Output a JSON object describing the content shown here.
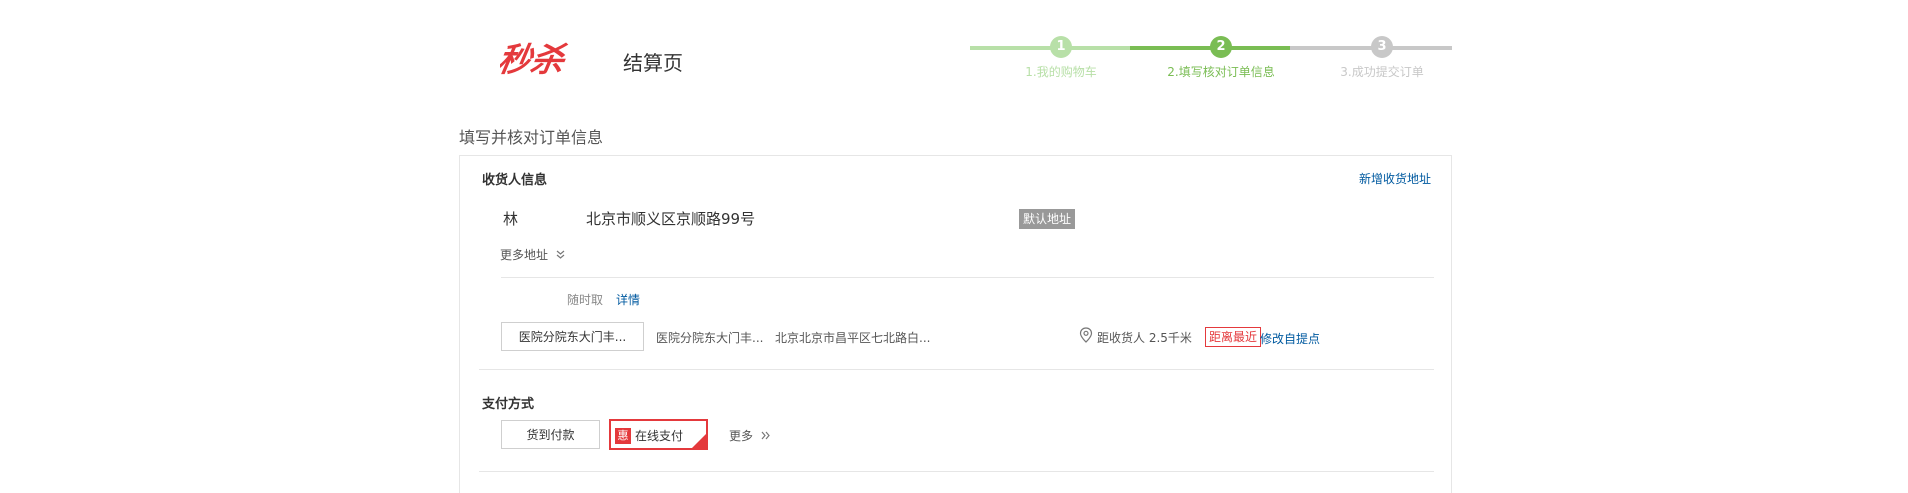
{
  "header": {
    "logo_text": "秒杀",
    "page_name": "结算页"
  },
  "steps": [
    {
      "number": "1",
      "label": "1.我的购物车",
      "color": "#b8e0a8"
    },
    {
      "number": "2",
      "label": "2.填写核对订单信息",
      "color": "#7abd54"
    },
    {
      "number": "3",
      "label": "3.成功提交订单",
      "color": "#c8c8c8"
    }
  ],
  "section_title": "填写并核对订单信息",
  "receiver": {
    "title": "收货人信息",
    "new_address_link": "新增收货地址",
    "name": "林",
    "address": "北京市顺义区京顺路99号",
    "default_badge": "默认地址",
    "more_addresses": "更多地址",
    "pickup_time_label": "随时取",
    "details_link": "详情",
    "pickup_point_btn": "医院分院东大门丰...",
    "pickup_point_name": "医院分院东大门丰...",
    "pickup_point_address": "北京北京市昌平区七北路白...",
    "distance_text": "距收货人 2.5千米",
    "nearest_badge": "距离最近",
    "modify_pickup_link": "修改自提点"
  },
  "payment": {
    "title": "支付方式",
    "cod_label": "货到付款",
    "online_badge": "惠",
    "online_label": "在线支付",
    "more_label": "更多"
  },
  "colors": {
    "brand_red": "#e4393c",
    "link_blue": "#005aa0",
    "step_done": "#b8e0a8",
    "step_current": "#7abd54",
    "step_todo": "#c8c8c8"
  }
}
